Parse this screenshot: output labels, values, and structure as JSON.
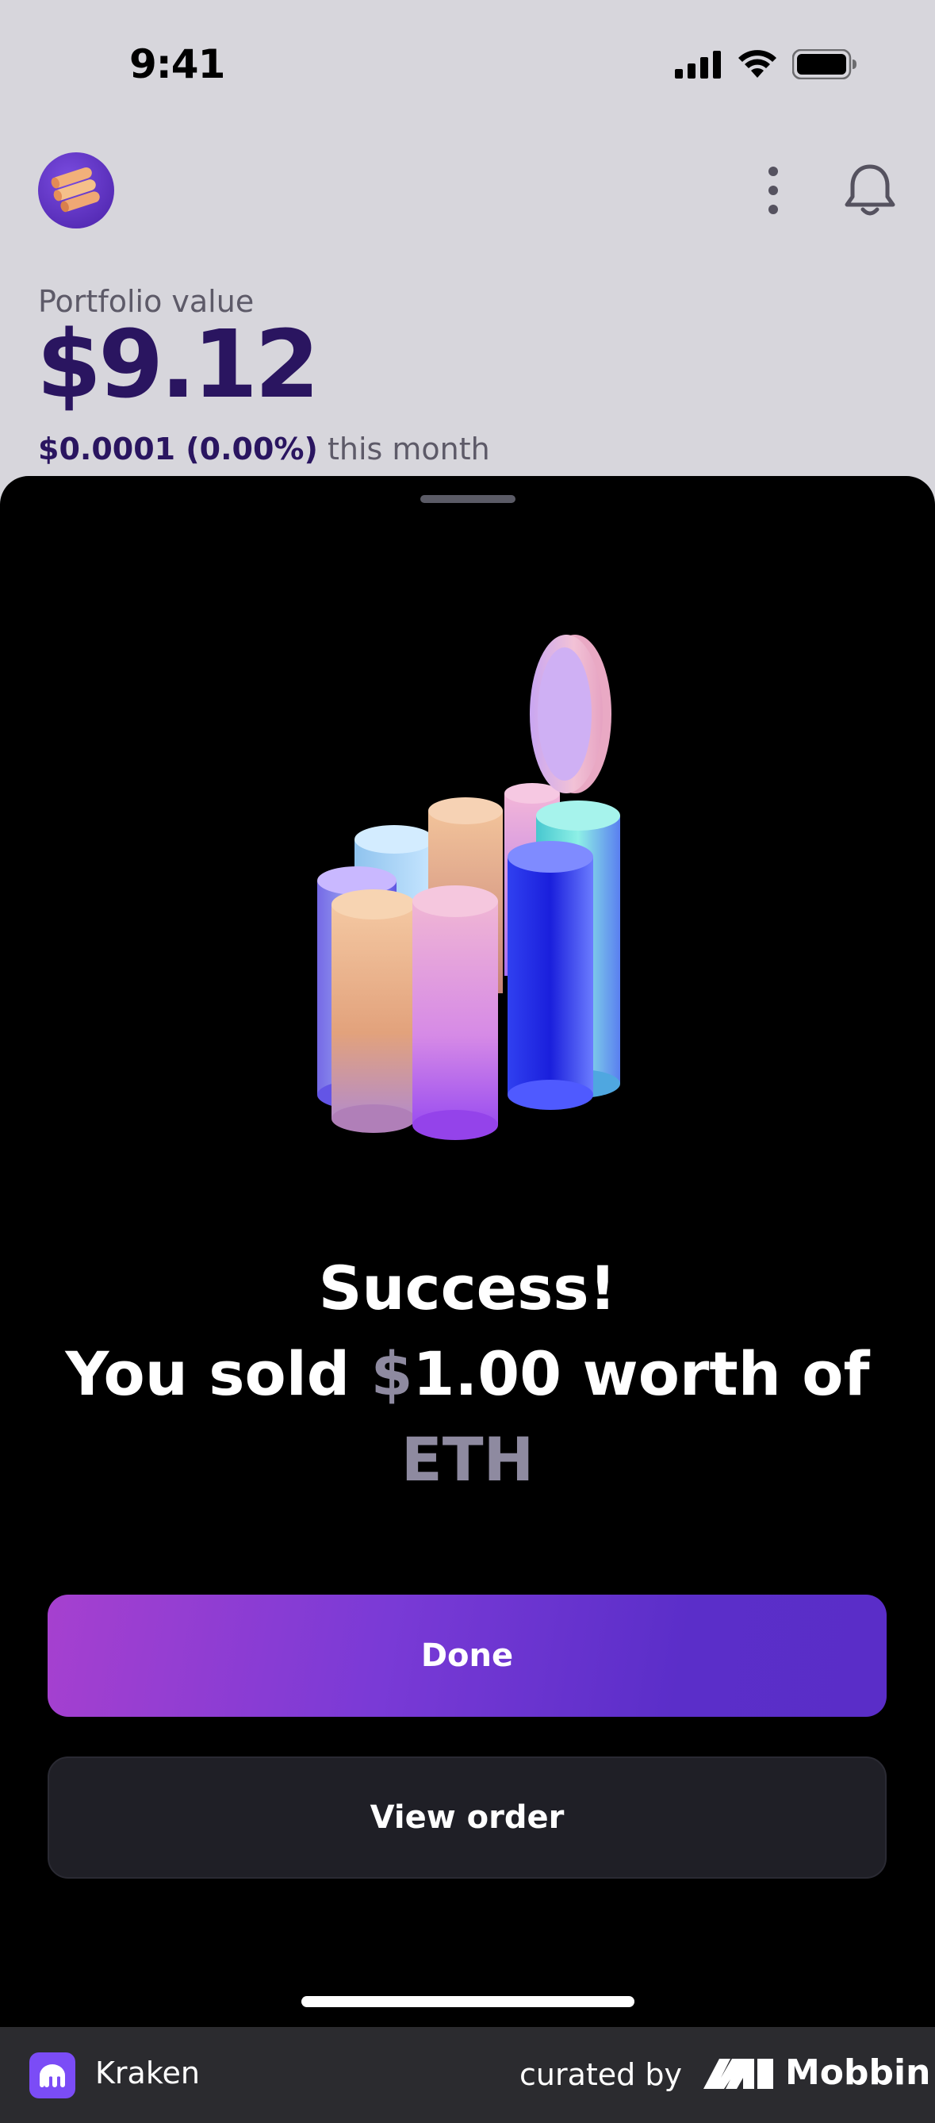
{
  "status_bar": {
    "time": "9:41"
  },
  "header": {
    "avatar": "coins-avatar-icon",
    "more": "more-vertical-icon",
    "notifications": "bell-icon"
  },
  "portfolio": {
    "label": "Portfolio value",
    "value": "$9.12",
    "change_amount": "$0.0001 (0.00%)",
    "change_suffix": "this month"
  },
  "sheet": {
    "title": "Success!",
    "message": {
      "prefix": "You sold ",
      "currency_symbol": "$",
      "amount": "1.00 worth of",
      "asset": "ETH"
    },
    "done_label": "Done",
    "view_order_label": "View order"
  },
  "footer": {
    "app_name": "Kraken",
    "curated_by": "curated by",
    "brand": "Mobbin"
  },
  "colors": {
    "accent": "#5b2ec9",
    "accent_start": "#a640cf",
    "portfolio_text": "#2a1560",
    "sheet_bg": "#000000",
    "top_bg": "#d7d6dc"
  }
}
